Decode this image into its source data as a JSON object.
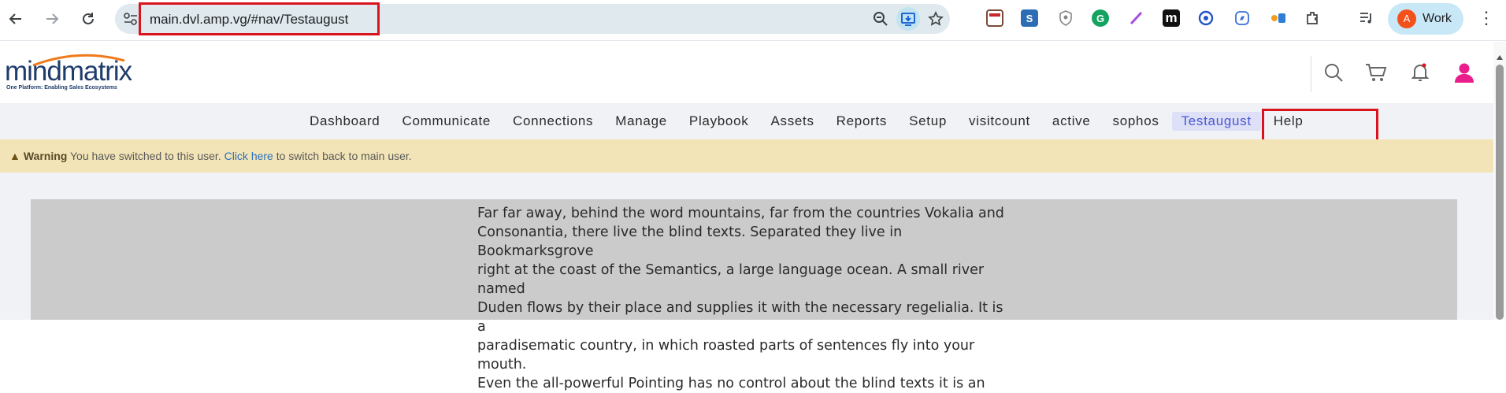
{
  "browser": {
    "url": "main.dvl.amp.vg/#nav/Testaugust",
    "profile_initial": "A",
    "profile_label": "Work"
  },
  "logo": {
    "name": "mindmatrix",
    "tagline": "One Platform: Enabling Sales Ecosystems"
  },
  "nav": {
    "items": [
      "Dashboard",
      "Communicate",
      "Connections",
      "Manage",
      "Playbook",
      "Assets",
      "Reports",
      "Setup",
      "visitcount",
      "active",
      "sophos",
      "Testaugust",
      "Help"
    ],
    "active": "Testaugust"
  },
  "warning": {
    "title": "Warning",
    "text_before": "You have switched to this user.",
    "link": "Click here",
    "text_after": "to switch back to main user."
  },
  "content": {
    "lines": [
      "Far far away, behind the word mountains, far from the countries Vokalia and",
      "Consonantia, there live the blind texts. Separated they live in Bookmarksgrove",
      "right at the coast of the Semantics, a large language ocean. A small river named",
      "Duden flows by their place and supplies it with the necessary regelialia. It is a",
      "paradisematic country, in which roasted parts of sentences fly into your mouth.",
      "Even the all-powerful Pointing has no control about the blind texts it is an"
    ]
  },
  "colors": {
    "brand_navy": "#1f3c6b",
    "brand_orange": "#f07a1a",
    "active_nav": "#4b56d2",
    "warning_bg": "#f2e4b6",
    "user_icon": "#e91e8c",
    "highlight_box": "#d9141e"
  },
  "icons": [
    "back-arrow-icon",
    "forward-arrow-icon",
    "reload-icon",
    "site-settings-icon",
    "zoom-icon",
    "install-icon",
    "star-icon",
    "extensions-icon",
    "media-icon",
    "search-icon",
    "cart-icon",
    "bell-icon",
    "user-icon"
  ]
}
